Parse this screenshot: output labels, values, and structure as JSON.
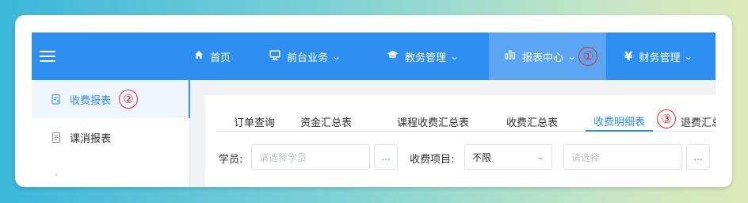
{
  "nav": {
    "items": [
      {
        "label": "首页",
        "icon": "home-icon"
      },
      {
        "label": "前台业务",
        "icon": "monitor-icon"
      },
      {
        "label": "教务管理",
        "icon": "graduation-cap-icon"
      },
      {
        "label": "报表中心",
        "icon": "bar-chart-icon"
      },
      {
        "label": "财务管理",
        "icon": "yen-icon"
      }
    ],
    "marker1": "①"
  },
  "sidebar": {
    "items": [
      {
        "label": "收费报表",
        "icon": "receipt-icon"
      },
      {
        "label": "课消报表",
        "icon": "document-icon"
      }
    ],
    "marker2": "②"
  },
  "tabs": {
    "items": [
      "订单查询",
      "资金汇总表",
      "课程收费汇总表",
      "收费汇总表",
      "收费明细表",
      "退费汇总表"
    ],
    "marker3": "③"
  },
  "filters": {
    "student_label": "学员:",
    "student_placeholder": "请选择学员",
    "more_label": "...",
    "fee_item_label": "收费项目:",
    "fee_item_value": "不限",
    "select_placeholder": "请选择"
  },
  "colors": {
    "primary": "#2f8ff0",
    "marker_red": "#e52a2a"
  }
}
